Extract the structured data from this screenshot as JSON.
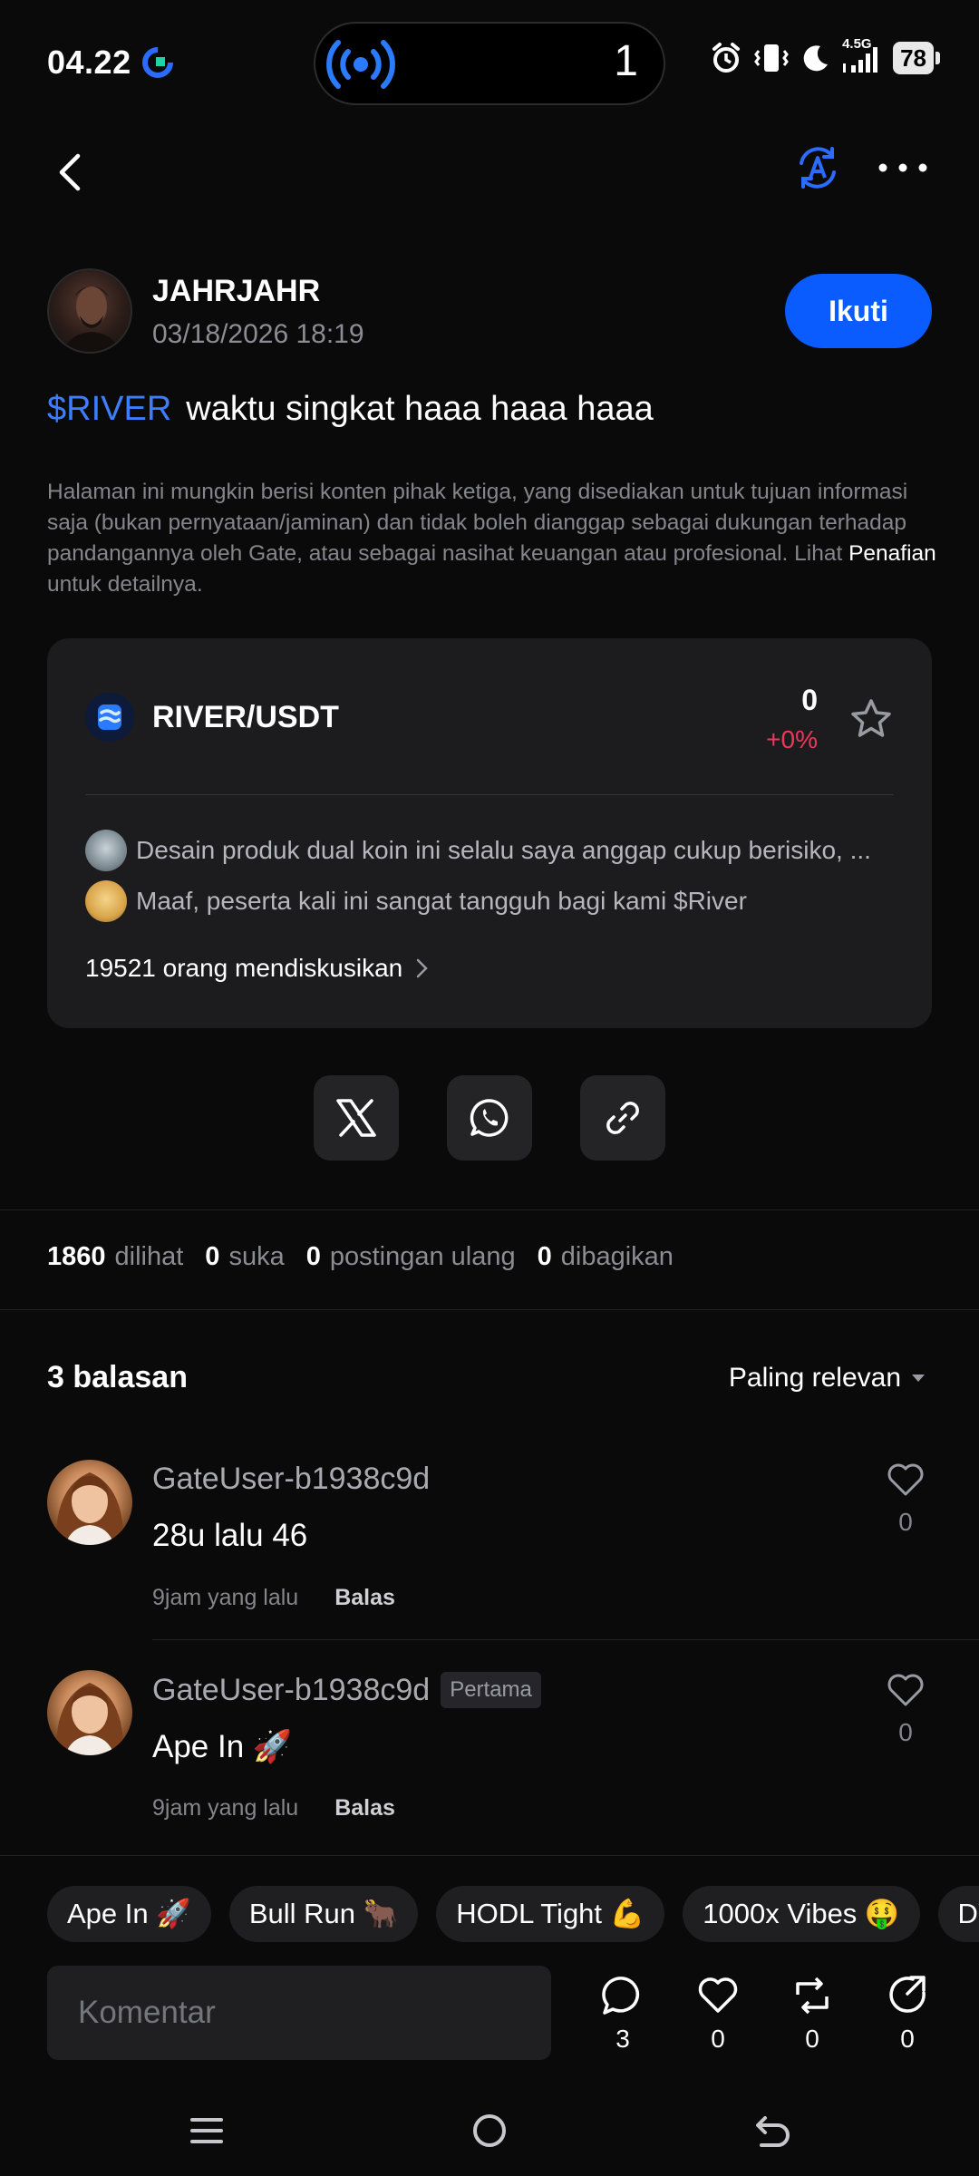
{
  "status_bar": {
    "time": "04.22",
    "island_count": "1",
    "network": "4.5G",
    "battery": "78"
  },
  "post": {
    "author": "JAHRJAHR",
    "datetime": "03/18/2026 18:19",
    "follow_label": "Ikuti",
    "tag": "$RIVER",
    "title": "waktu singkat haaa haaa haaa",
    "disclaimer_text": "Halaman ini mungkin berisi konten pihak ketiga, yang disediakan untuk tujuan informasi saja (bukan pernyataan/jaminan) dan tidak boleh dianggap sebagai dukungan terhadap pandangannya oleh Gate, atau sebagai nasihat keuangan atau profesional. Lihat ",
    "disclaimer_link": "Penafian",
    "disclaimer_tail": " untuk detailnya."
  },
  "market_card": {
    "pair": "RIVER/USDT",
    "price": "0",
    "change": "+0%",
    "change_color": "#f0365b",
    "discussions": [
      "Desain produk dual koin ini selalu saya anggap cukup berisiko, ...",
      "Maaf, peserta kali ini sangat tangguh bagi kami $River"
    ],
    "discussing_count": "19521 orang mendiskusikan"
  },
  "stats": {
    "views": "1860",
    "views_label": "dilihat",
    "likes": "0",
    "likes_label": "suka",
    "reposts": "0",
    "reposts_label": "postingan ulang",
    "shares": "0",
    "shares_label": "dibagikan"
  },
  "replies": {
    "title": "3 balasan",
    "sort": "Paling relevan",
    "items": [
      {
        "user": "GateUser-b1938c9d",
        "badge": "",
        "text": "28u lalu 46",
        "time": "9jam yang lalu",
        "reply": "Balas",
        "likes": "0"
      },
      {
        "user": "GateUser-b1938c9d",
        "badge": "Pertama",
        "text": "Ape In 🚀",
        "time": "9jam yang lalu",
        "reply": "Balas",
        "likes": "0"
      }
    ]
  },
  "quick_replies": [
    "Ape In 🚀",
    "Bull Run 🐂",
    "HODL Tight 💪",
    "1000x Vibes 🤑",
    "DY"
  ],
  "composer": {
    "placeholder": "Komentar",
    "comments": "3",
    "likes": "0",
    "reposts": "0",
    "shares": "0"
  },
  "colors": {
    "accent": "#0a5cff",
    "tag": "#3d7eff",
    "background": "#0a0a0b",
    "card": "#1c1c1f"
  }
}
